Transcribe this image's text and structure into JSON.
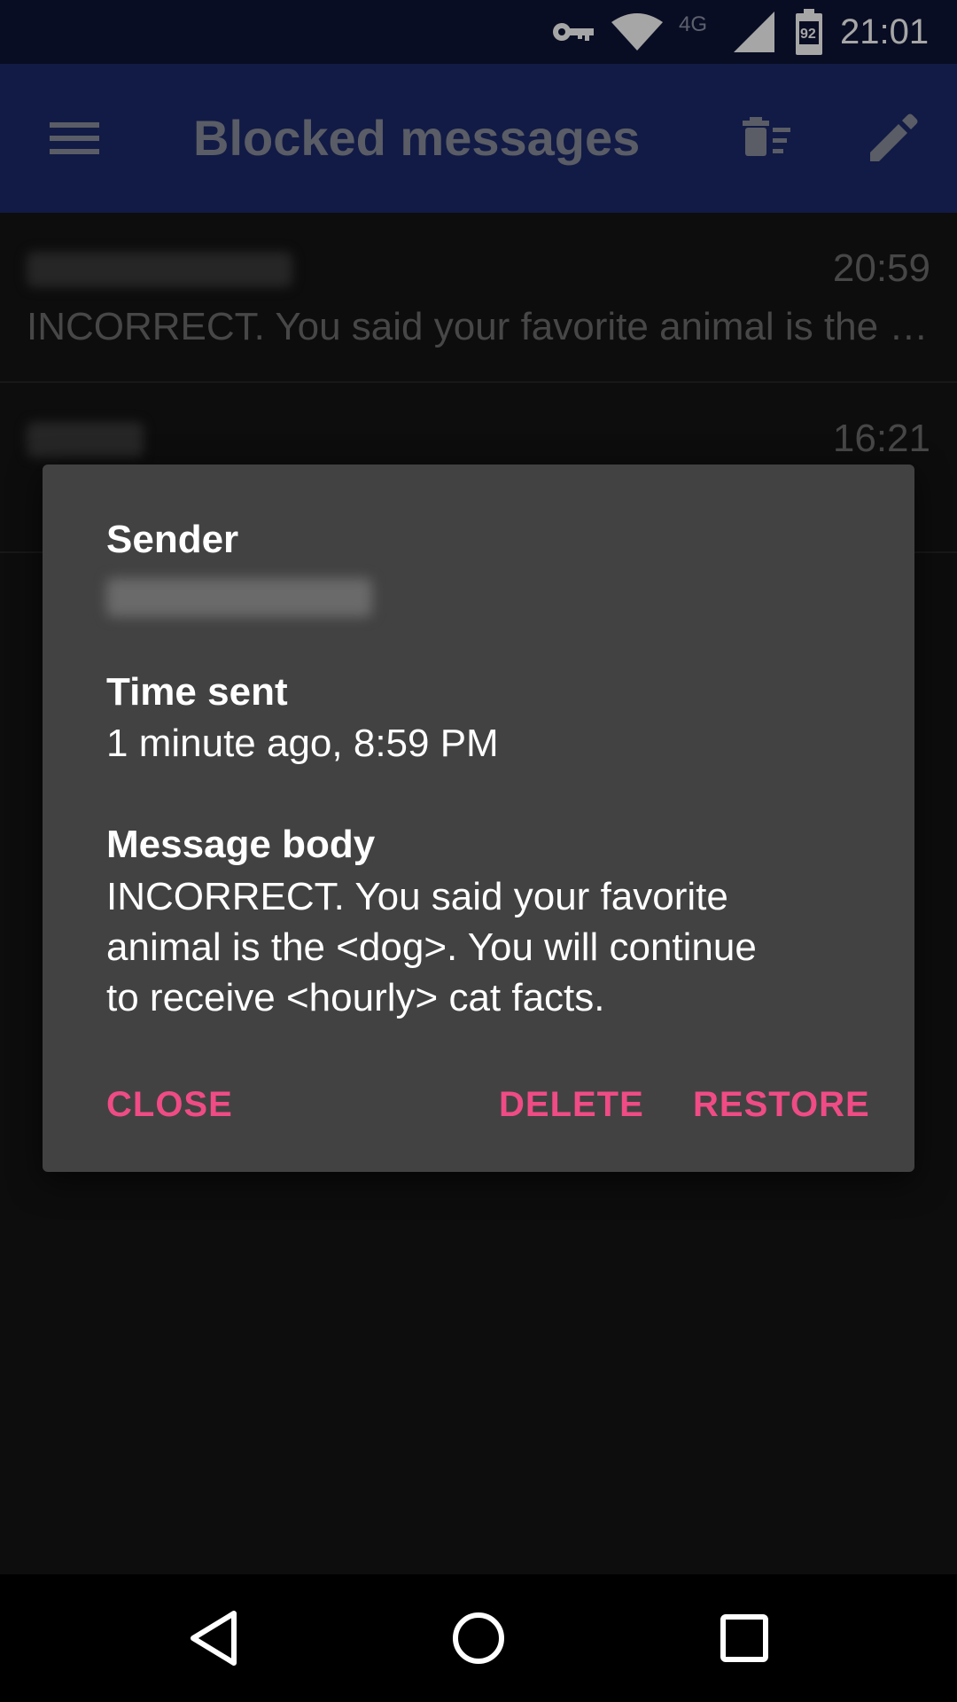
{
  "status_bar": {
    "network": "4G",
    "battery": "92",
    "time": "21:01",
    "icons": [
      "vpn-key-icon",
      "wifi-icon",
      "cell-signal-icon",
      "battery-icon"
    ]
  },
  "app_bar": {
    "title": "Blocked messages",
    "icons": [
      "menu-icon",
      "delete-sweep-icon",
      "edit-icon"
    ]
  },
  "messages": [
    {
      "time": "20:59",
      "snippet": "INCORRECT. You said your favorite animal is the <dog>. You will continue to receive <hourly> cat facts."
    },
    {
      "time": "16:21",
      "snippet": ""
    }
  ],
  "dialog": {
    "sender_label": "Sender",
    "time_label": "Time sent",
    "time_value": "1 minute ago, 8:59 PM",
    "body_label": "Message body",
    "body_lines": [
      "INCORRECT. You said your favorite",
      "animal is the <dog>. You will continue",
      "to receive <hourly> cat facts."
    ],
    "buttons": {
      "close": "CLOSE",
      "delete": "DELETE",
      "restore": "RESTORE"
    }
  },
  "colors": {
    "status_bar_bg": "#0e1536",
    "app_bar_bg": "#1d2a6b",
    "dialog_bg": "#424242",
    "accent": "#ef4b85"
  },
  "nav_bar": {
    "icons": [
      "back-icon",
      "home-icon",
      "recents-icon"
    ]
  }
}
